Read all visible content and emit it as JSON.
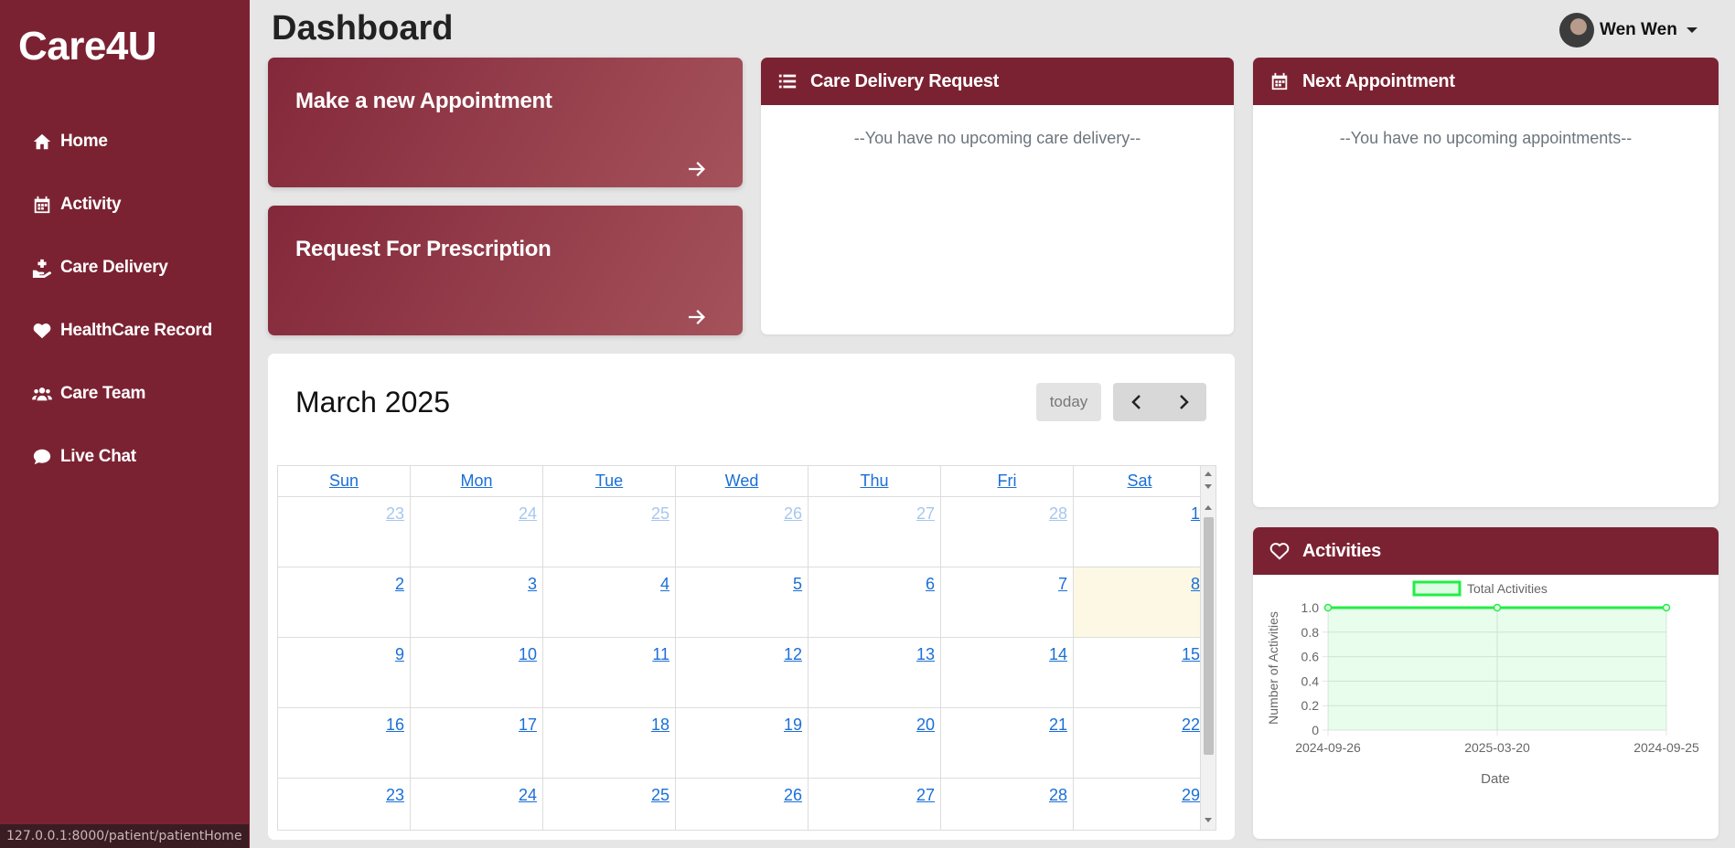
{
  "app": {
    "brand": "Care4U",
    "status_url": "127.0.0.1:8000/patient/patientHome"
  },
  "sidebar": {
    "items": [
      {
        "label": "Home",
        "icon": "home-icon"
      },
      {
        "label": "Activity",
        "icon": "calendar-icon"
      },
      {
        "label": "Care Delivery",
        "icon": "hand-holding-medical-icon"
      },
      {
        "label": "HealthCare Record",
        "icon": "heart-icon"
      },
      {
        "label": "Care Team",
        "icon": "users-icon"
      },
      {
        "label": "Live Chat",
        "icon": "chat-icon"
      }
    ]
  },
  "header": {
    "title": "Dashboard",
    "user_name": "Wen Wen"
  },
  "actions": {
    "appointment": "Make a new Appointment",
    "prescription": "Request For Prescription"
  },
  "care_delivery": {
    "title": "Care Delivery Request",
    "empty": "--You have no upcoming care delivery--"
  },
  "next_appointment": {
    "title": "Next Appointment",
    "empty": "--You have no upcoming appointments--"
  },
  "calendar": {
    "title": "March 2025",
    "today_label": "today",
    "days_of_week": [
      "Sun",
      "Mon",
      "Tue",
      "Wed",
      "Thu",
      "Fri",
      "Sat"
    ],
    "weeks": [
      [
        "23",
        "24",
        "25",
        "26",
        "27",
        "28",
        "1"
      ],
      [
        "2",
        "3",
        "4",
        "5",
        "6",
        "7",
        "8"
      ],
      [
        "9",
        "10",
        "11",
        "12",
        "13",
        "14",
        "15"
      ],
      [
        "16",
        "17",
        "18",
        "19",
        "20",
        "21",
        "22"
      ],
      [
        "23",
        "24",
        "25",
        "26",
        "27",
        "28",
        "29"
      ]
    ],
    "today_day": "8"
  },
  "activities": {
    "title": "Activities",
    "chart_data": {
      "type": "line",
      "x": [
        "2024-09-26",
        "2025-03-20",
        "2024-09-25"
      ],
      "series": [
        {
          "name": "Total Activities",
          "values": [
            1,
            1,
            1
          ],
          "color": "#22ee44"
        }
      ],
      "xlabel": "Date",
      "ylabel": "Number of Activities",
      "ylim": [
        0,
        1.0
      ],
      "yticks": [
        "0",
        "0.2",
        "0.4",
        "0.6",
        "0.8",
        "1.0"
      ],
      "legend": "top",
      "grid": true
    }
  }
}
